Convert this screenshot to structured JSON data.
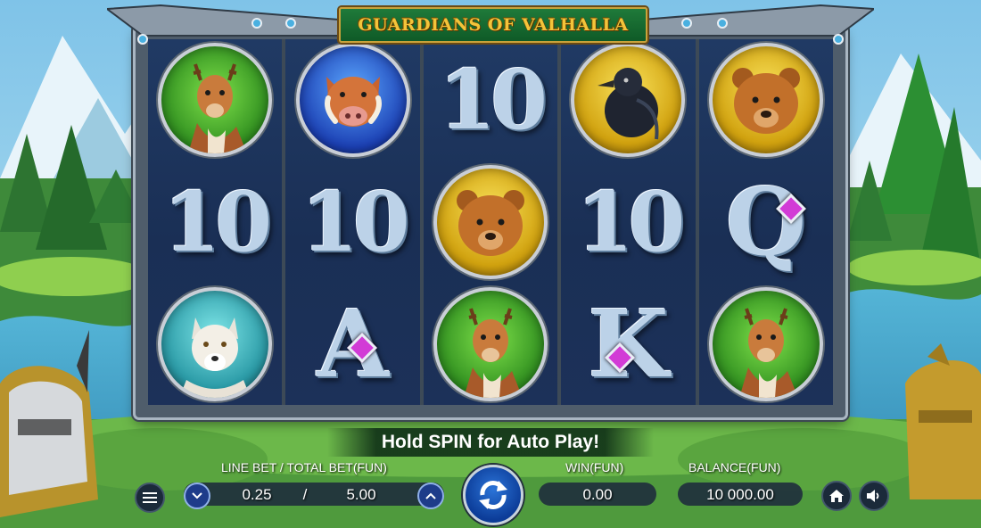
{
  "game": {
    "title": "GUARDIANS OF VALHALLA"
  },
  "reels": [
    [
      "deer",
      "boar",
      "bear"
    ],
    [
      "ten",
      "ten",
      "ace"
    ],
    [
      "ten",
      "bear",
      "deer"
    ],
    [
      "raven",
      "ten",
      "king"
    ],
    [
      "bear",
      "queen",
      "deer"
    ]
  ],
  "grid": {
    "row1": [
      "deer",
      "boar",
      "ten",
      "raven",
      "bear"
    ],
    "row2": [
      "ten",
      "ten",
      "bear",
      "ten",
      "queen"
    ],
    "row3": [
      "wolf",
      "ace",
      "deer",
      "king",
      "deer"
    ]
  },
  "symbol_text": {
    "ten": "10",
    "ace": "A",
    "king": "K",
    "queen": "Q"
  },
  "banner": {
    "text": "HOLD SPIN FOR AUTO PLAY!",
    "display": "Hold SPIN for Auto Play!"
  },
  "bet": {
    "label": "LINE BET / TOTAL BET(FUN)",
    "line_bet": "0.25",
    "separator": "/",
    "total_bet": "5.00"
  },
  "win": {
    "label": "WIN(FUN)",
    "value": "0.00"
  },
  "balance": {
    "label": "BALANCE(FUN)",
    "value": "10 000.00"
  },
  "icons": {
    "menu": "menu-icon",
    "bet_down": "chevron-down-icon",
    "bet_up": "chevron-up-icon",
    "spin": "spin-arrows-icon",
    "home": "home-icon",
    "sound": "speaker-icon"
  },
  "colors": {
    "title_gold": "#f3c43a",
    "title_plate_green": "#1f7a3a",
    "reel_bg": "#1a2f55",
    "spin_blue": "#1d5cc0",
    "gem_magenta": "#d23bd6"
  }
}
